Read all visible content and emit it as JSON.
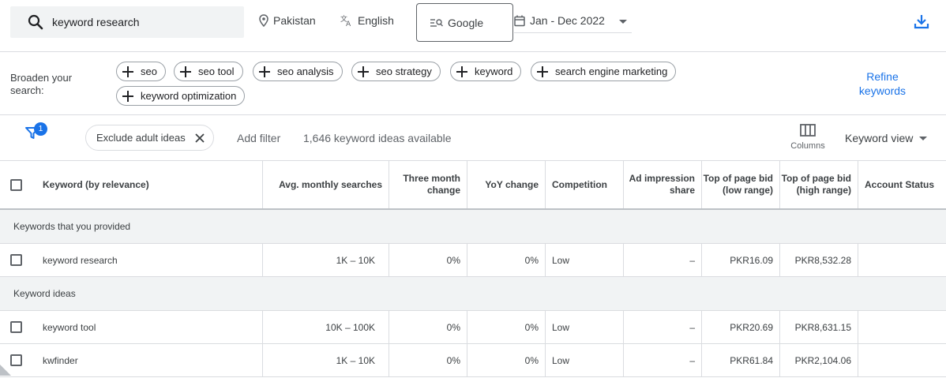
{
  "search": {
    "value": "keyword research",
    "icon": "search-icon"
  },
  "location": {
    "label": "Pakistan",
    "icon": "location-pin-icon"
  },
  "language": {
    "label": "English",
    "icon": "translate-icon"
  },
  "engine": {
    "label": "Google",
    "icon": "search-network-icon"
  },
  "date_range": {
    "label": "Jan - Dec 2022",
    "icon": "calendar-icon"
  },
  "download": {
    "icon": "download-icon"
  },
  "broaden": {
    "label": "Broaden your search:",
    "chips": [
      "seo",
      "seo tool",
      "seo analysis",
      "seo strategy",
      "keyword",
      "search engine marketing",
      "keyword optimization"
    ],
    "refine_label": "Refine keywords"
  },
  "filterbar": {
    "filter_badge": "1",
    "exclude_label": "Exclude adult ideas",
    "add_filter": "Add filter",
    "ideas_count": "1,646 keyword ideas available",
    "columns_label": "Columns",
    "view_label": "Keyword view"
  },
  "table": {
    "headers": {
      "keyword": "Keyword (by relevance)",
      "avg": "Avg. monthly searches",
      "three_month": "Three month change",
      "yoy": "YoY change",
      "competition": "Competition",
      "ad_share": "Ad impression share",
      "bid_low": "Top of page bid (low range)",
      "bid_high": "Top of page bid (high range)",
      "account": "Account Status"
    },
    "groups": {
      "provided": "Keywords that you provided",
      "ideas": "Keyword ideas"
    },
    "rows": [
      {
        "keyword": "keyword research",
        "avg": "1K – 10K",
        "three_month": "0%",
        "yoy": "0%",
        "competition": "Low",
        "ad_share": "–",
        "bid_low": "PKR16.09",
        "bid_high": "PKR8,532.28"
      },
      {
        "keyword": "keyword tool",
        "avg": "10K – 100K",
        "three_month": "0%",
        "yoy": "0%",
        "competition": "Low",
        "ad_share": "–",
        "bid_low": "PKR20.69",
        "bid_high": "PKR8,631.15"
      },
      {
        "keyword": "kwfinder",
        "avg": "1K – 10K",
        "three_month": "0%",
        "yoy": "0%",
        "competition": "Low",
        "ad_share": "–",
        "bid_low": "PKR61.84",
        "bid_high": "PKR2,104.06"
      }
    ]
  },
  "colors": {
    "accent": "#1a73e8",
    "text": "#3c4043",
    "group_bg": "#f1f3f4"
  }
}
